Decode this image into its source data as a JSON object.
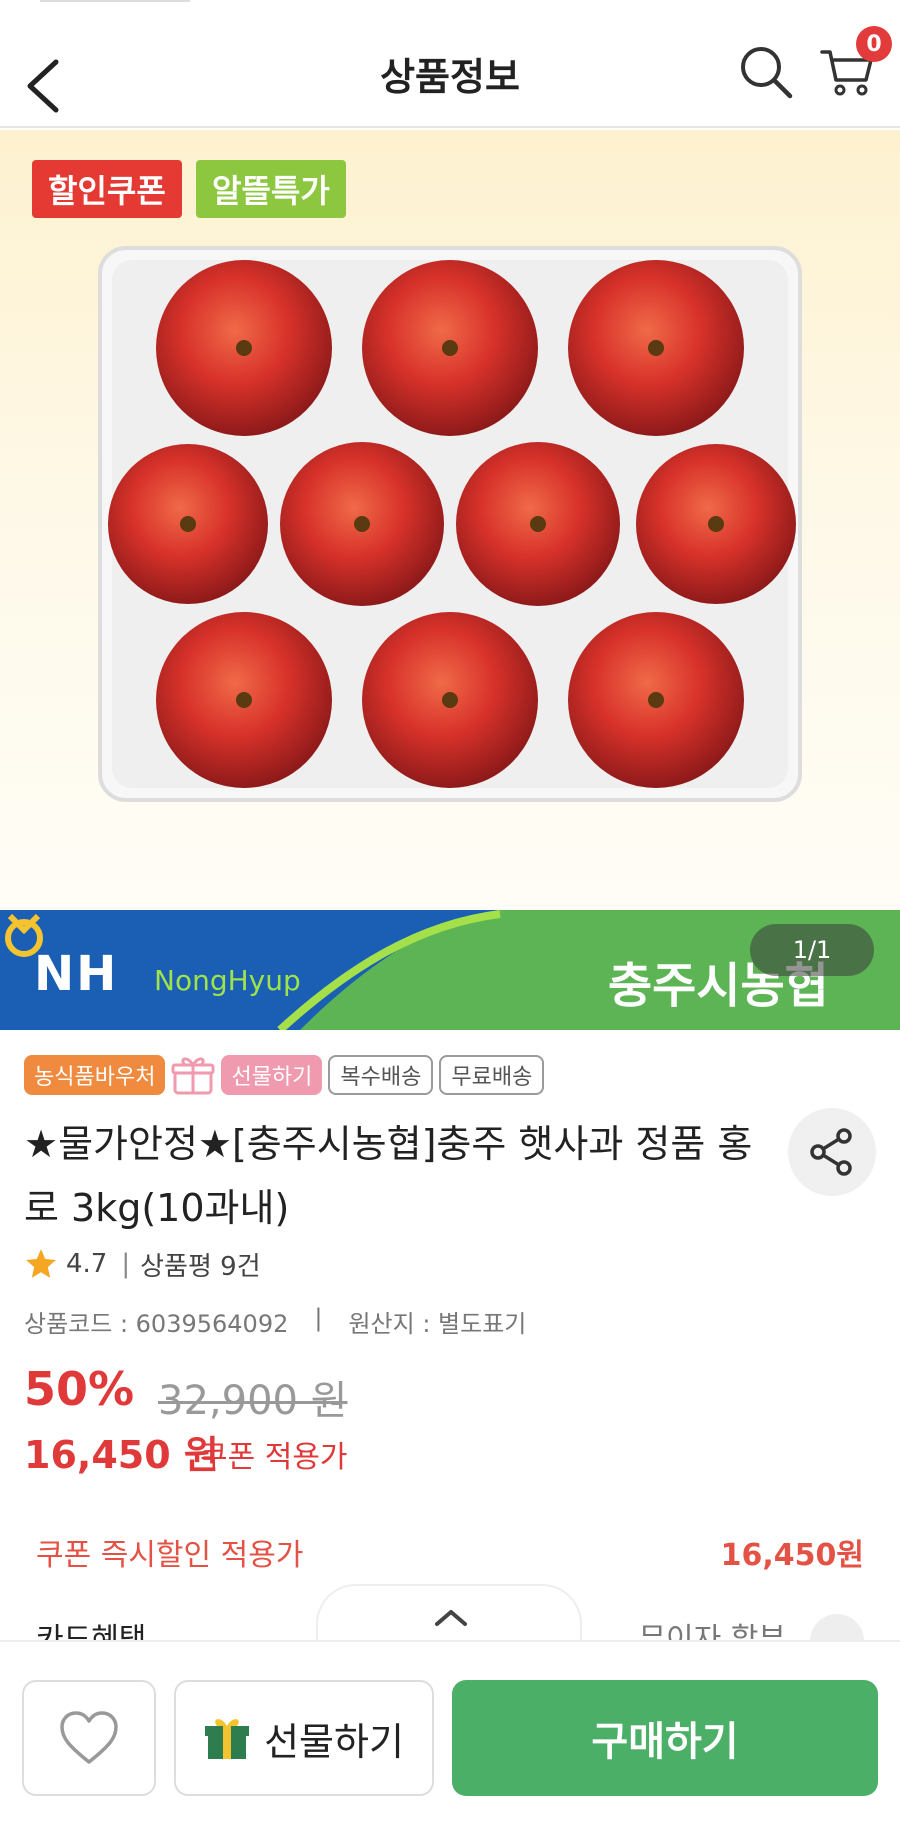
{
  "header": {
    "title": "상품정보",
    "cart_count": "0"
  },
  "hero": {
    "tags": [
      "할인쿠폰",
      "알뜰특가"
    ],
    "image_pager": "1/1"
  },
  "banner": {
    "left_logo": "NH",
    "left_sub": "NongHyup",
    "right_text": "충주시농협"
  },
  "product": {
    "badges": {
      "voucher": "농식품바우처",
      "gift": "선물하기",
      "multi_ship": "복수배송",
      "free_ship": "무료배송"
    },
    "name": "★물가안정★[충주시농협]충주 햇사과 정품 홍로 3kg(10과내)",
    "rating": "4.7",
    "review_label": "상품평 9건",
    "code_label": "상품코드 : 6039564092",
    "origin_label": "원산지 : 별도표기",
    "discount_rate": "50%",
    "original_price": "32,900 원",
    "sale_price": "16,450 원",
    "sale_note": "쿠폰 적용가"
  },
  "benefits": {
    "coupon_label": "쿠폰 즉시할인 적용가",
    "coupon_value": "16,450원",
    "card_label": "카드혜택",
    "card_right": "무이자 할부"
  },
  "bottom_bar": {
    "gift_label": "선물하기",
    "buy_label": "구매하기"
  },
  "colors": {
    "accent_red": "#e0393a",
    "buy_green": "#4caf68",
    "tag_red": "#e53a34",
    "tag_green": "#8dc63f"
  }
}
